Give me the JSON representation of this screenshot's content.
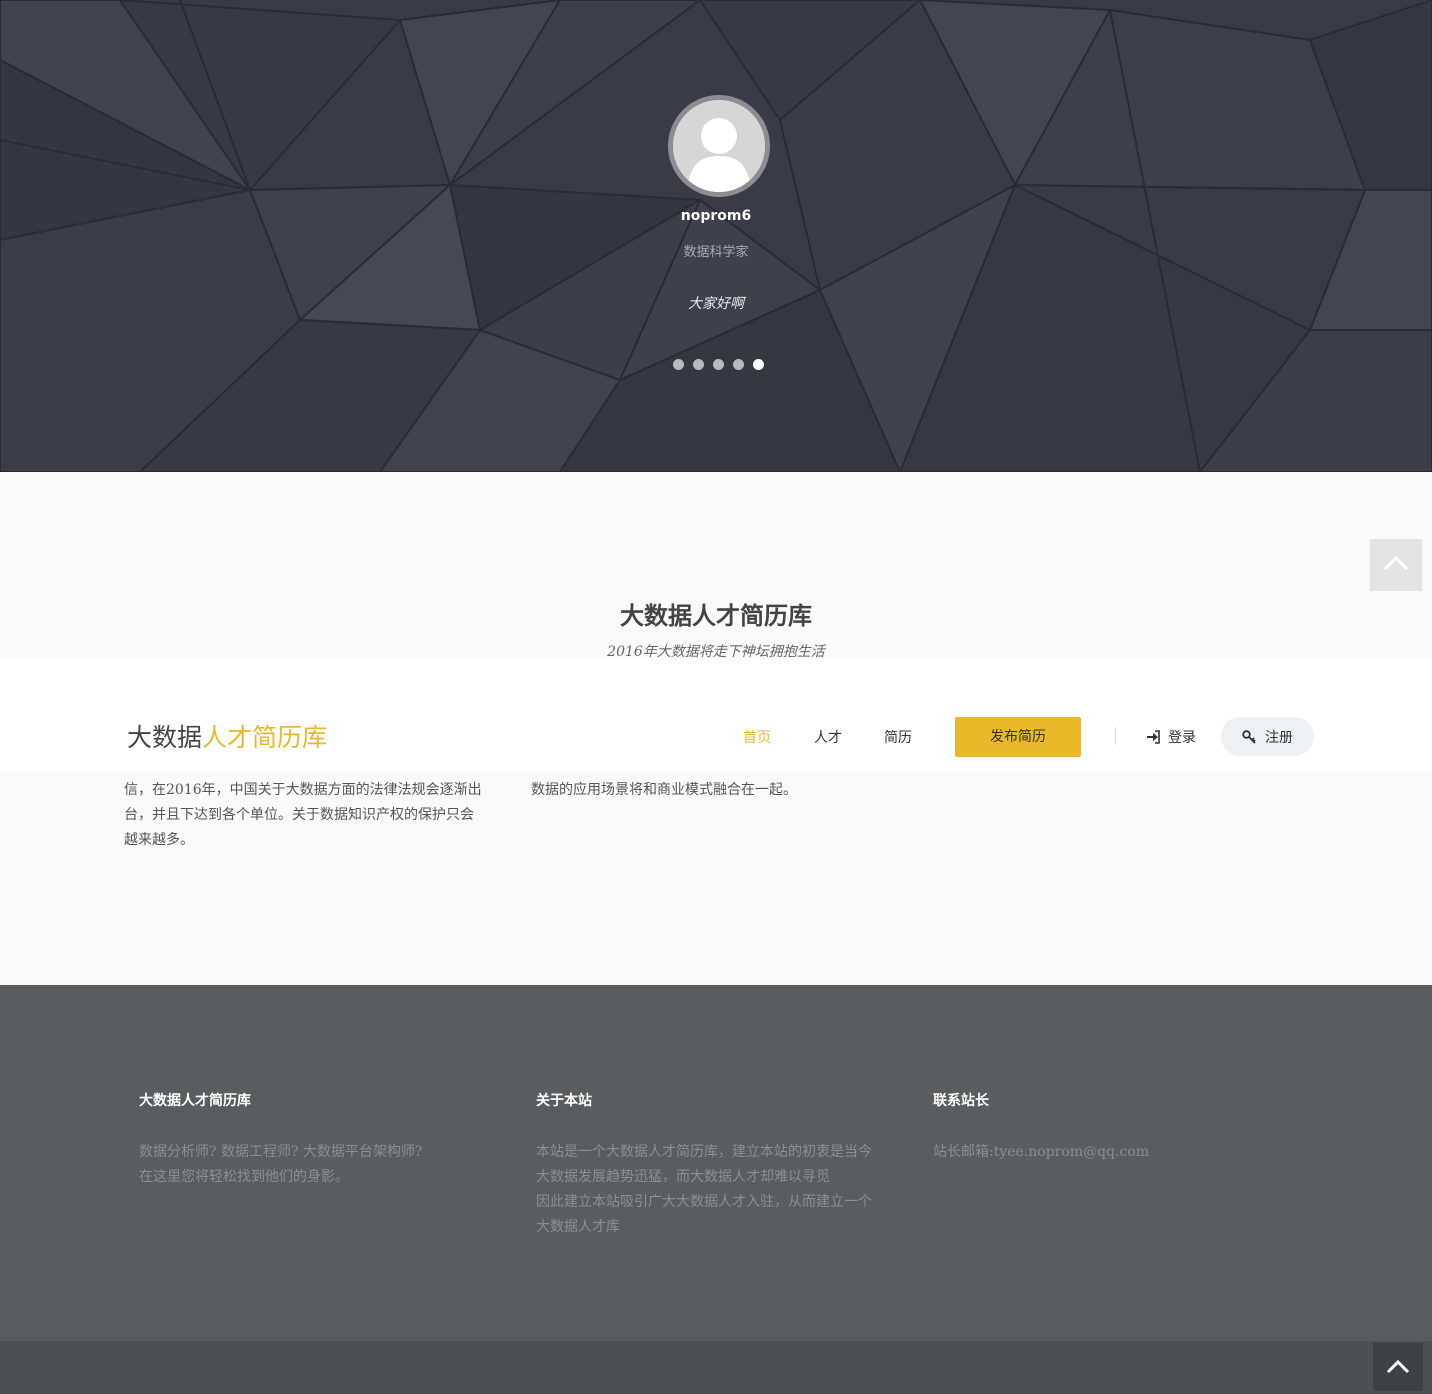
{
  "hero": {
    "name": "noprom6",
    "role": "数据科学家",
    "quote": "大家好啊",
    "carousel": {
      "count": 5,
      "active_index": 5
    }
  },
  "section": {
    "title": "大数据人才简历库",
    "subtitle": "2016年大数据将走下神坛拥抱生活"
  },
  "navbar": {
    "logo_part1": "大数据",
    "logo_part2": "人才",
    "logo_part3": "简历库",
    "items": [
      "首页",
      "人才",
      "简历"
    ],
    "active_item": "首页",
    "publish_label": "发布简历",
    "login_label": "登录",
    "register_label": "注册"
  },
  "content": {
    "col1_lines": [
      "信，在2016年，中国关于大数据方面的法律法规会逐渐出",
      "台，并且下达到各个单位。关于数据知识产权的保护只会",
      "越来越多。"
    ],
    "col2_lines": [
      "数据的应用场景将和商业模式融合在一起。"
    ]
  },
  "footer": {
    "col1": {
      "title": "大数据人才简历库",
      "lines": [
        "数据分析师? 数据工程师? 大数据平台架构师?",
        "在这里您将轻松找到他们的身影。"
      ]
    },
    "col2": {
      "title": "关于本站",
      "lines": [
        "本站是一个大数据人才简历库，建立本站的初衷是当今",
        "大数据发展趋势迅猛，而大数据人才却难以寻觅",
        "因此建立本站吸引广大大数据人才入驻，从而建立一个",
        "大数据人才库"
      ]
    },
    "col3": {
      "title": "联系站长",
      "lines": [
        "站长邮箱:tyee.noprom@qq.com"
      ]
    }
  },
  "colors": {
    "accent": "#eab92a",
    "hero_bg": "#3a3b46",
    "footer_bg": "#595d5f",
    "bottombar_bg": "#4d5153"
  },
  "icons": [
    "user-avatar-icon",
    "chevron-up-icon",
    "sign-in-icon",
    "key-icon"
  ]
}
